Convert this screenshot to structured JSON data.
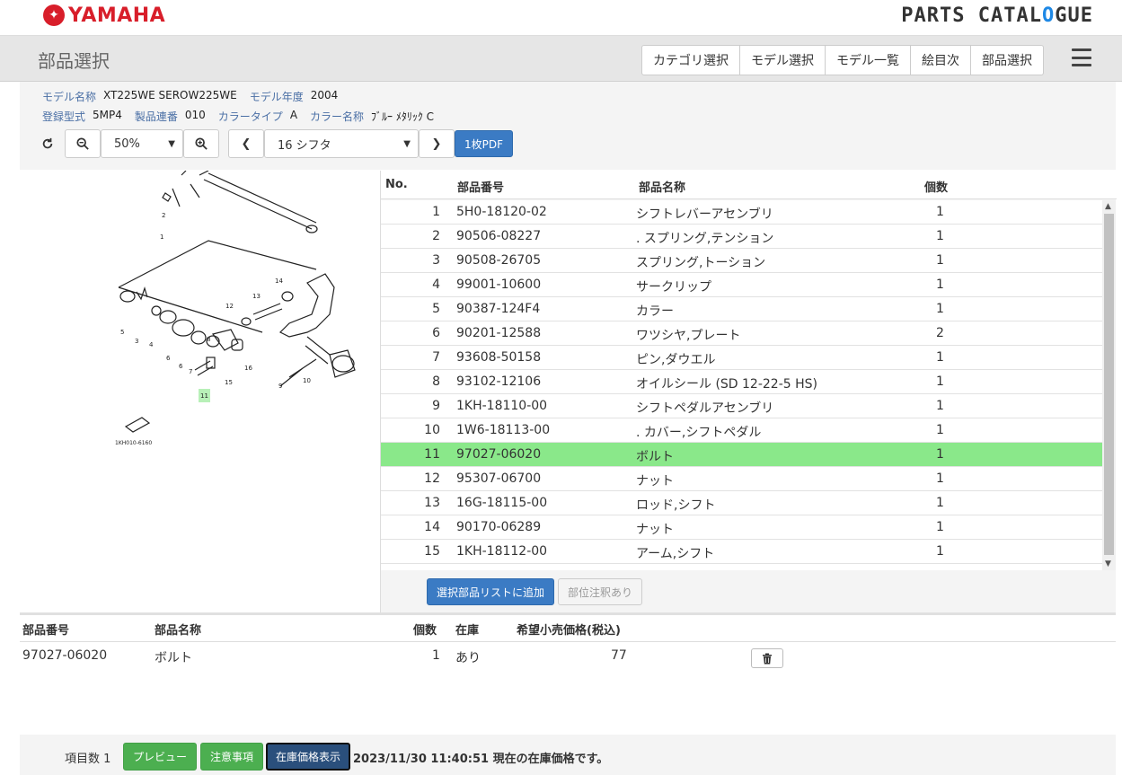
{
  "header": {
    "brand": "YAMAHA",
    "catalogue_prefix": "PARTS CATAL",
    "catalogue_gear": "O",
    "catalogue_suffix": "GUE"
  },
  "page": {
    "title": "部品選択",
    "nav": [
      "カテゴリ選択",
      "モデル選択",
      "モデル一覧",
      "絵目次",
      "部品選択"
    ]
  },
  "model_info": {
    "model_name_label": "モデル名称",
    "model_name": "XT225WE SEROW225WE",
    "model_year_label": "モデル年度",
    "model_year": "2004",
    "reg_type_label": "登録型式",
    "reg_type": "5MP4",
    "serial_label": "製品連番",
    "serial": "010",
    "color_type_label": "カラータイプ",
    "color_type": "A",
    "color_name_label": "カラー名称",
    "color_name": "ﾌﾞﾙｰ ﾒﾀﾘｯｸ C"
  },
  "toolbar": {
    "zoom": "50%",
    "page_select": "16 シフタ",
    "pdf_label": "1枚PDF"
  },
  "diagram": {
    "code": "1KH010-6160"
  },
  "parts_table": {
    "headers": {
      "no": "No.",
      "part_number": "部品番号",
      "part_name": "部品名称",
      "qty": "個数"
    },
    "rows": [
      {
        "no": "1",
        "part_number": "5H0-18120-02",
        "part_name": "シフトレバーアセンブリ",
        "qty": "1"
      },
      {
        "no": "2",
        "part_number": "90506-08227",
        "part_name": ". スプリング,テンション",
        "qty": "1"
      },
      {
        "no": "3",
        "part_number": "90508-26705",
        "part_name": "スプリング,トーション",
        "qty": "1"
      },
      {
        "no": "4",
        "part_number": "99001-10600",
        "part_name": "サークリップ",
        "qty": "1"
      },
      {
        "no": "5",
        "part_number": "90387-124F4",
        "part_name": "カラー",
        "qty": "1"
      },
      {
        "no": "6",
        "part_number": "90201-12588",
        "part_name": "ワツシヤ,プレート",
        "qty": "2"
      },
      {
        "no": "7",
        "part_number": "93608-50158",
        "part_name": "ピン,ダウエル",
        "qty": "1"
      },
      {
        "no": "8",
        "part_number": "93102-12106",
        "part_name": "オイルシール (SD 12-22-5 HS)",
        "qty": "1"
      },
      {
        "no": "9",
        "part_number": "1KH-18110-00",
        "part_name": "シフトペダルアセンブリ",
        "qty": "1"
      },
      {
        "no": "10",
        "part_number": "1W6-18113-00",
        "part_name": ". カバー,シフトペダル",
        "qty": "1"
      },
      {
        "no": "11",
        "part_number": "97027-06020",
        "part_name": "ボルト",
        "qty": "1"
      },
      {
        "no": "12",
        "part_number": "95307-06700",
        "part_name": "ナット",
        "qty": "1"
      },
      {
        "no": "13",
        "part_number": "16G-18115-00",
        "part_name": "ロッド,シフト",
        "qty": "1"
      },
      {
        "no": "14",
        "part_number": "90170-06289",
        "part_name": "ナット",
        "qty": "1"
      },
      {
        "no": "15",
        "part_number": "1KH-18112-00",
        "part_name": "アーム,シフト",
        "qty": "1"
      }
    ],
    "selected_index": 10,
    "add_button": "選択部品リストに追加",
    "note_button": "部位注釈あり"
  },
  "selected_list": {
    "headers": {
      "part_number": "部品番号",
      "part_name": "部品名称",
      "qty": "個数",
      "stock": "在庫",
      "price": "希望小売価格(税込)"
    },
    "rows": [
      {
        "part_number": "97027-06020",
        "part_name": "ボルト",
        "qty": "1",
        "stock": "あり",
        "price": "77"
      }
    ]
  },
  "footer": {
    "count_label": "項目数 1",
    "preview": "プレビュー",
    "caution": "注意事項",
    "stock_price": "在庫価格表示",
    "status": "2023/11/30 11:40:51 現在の在庫価格です。"
  },
  "colors": {
    "brand_red": "#d81e2a",
    "primary_blue": "#3b7bc4",
    "selected_row": "#8ae88a",
    "green_button": "#4caf50"
  }
}
